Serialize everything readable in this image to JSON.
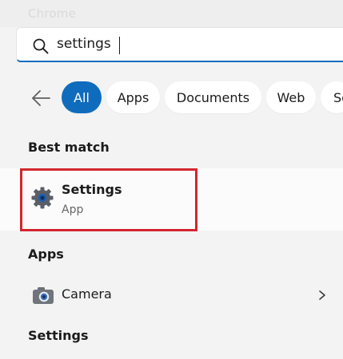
{
  "window": {
    "faded_title": "Chrome"
  },
  "search": {
    "value": "settings"
  },
  "filters": {
    "chips": [
      {
        "label": "All",
        "active": true
      },
      {
        "label": "Apps",
        "active": false
      },
      {
        "label": "Documents",
        "active": false
      },
      {
        "label": "Web",
        "active": false
      },
      {
        "label": "Se",
        "active": false
      }
    ]
  },
  "best_match": {
    "heading": "Best match",
    "title": "Settings",
    "subtitle": "App"
  },
  "apps": {
    "heading": "Apps",
    "items": [
      {
        "label": "Camera",
        "icon": "camera-icon"
      }
    ]
  },
  "settings_section": {
    "heading": "Settings"
  },
  "colors": {
    "accent": "#0f6cbd",
    "highlight": "#d3262e",
    "background": "#f3f3f3"
  }
}
